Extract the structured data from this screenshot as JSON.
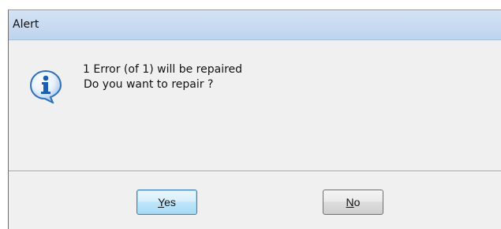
{
  "dialog": {
    "title": "Alert",
    "icon": "information-icon",
    "message_line1": "1 Error (of 1) will be repaired",
    "message_line2": "Do you want to repair ?",
    "buttons": {
      "yes": {
        "mnemonic": "Y",
        "rest": "es",
        "label": "Yes"
      },
      "no": {
        "mnemonic": "N",
        "rest": "o",
        "label": "No"
      }
    }
  },
  "colors": {
    "title_bar": "#c9dbf1",
    "body": "#f0f0f0",
    "icon_blue": "#1c5fb0",
    "default_button_border": "#3c7fb1"
  }
}
